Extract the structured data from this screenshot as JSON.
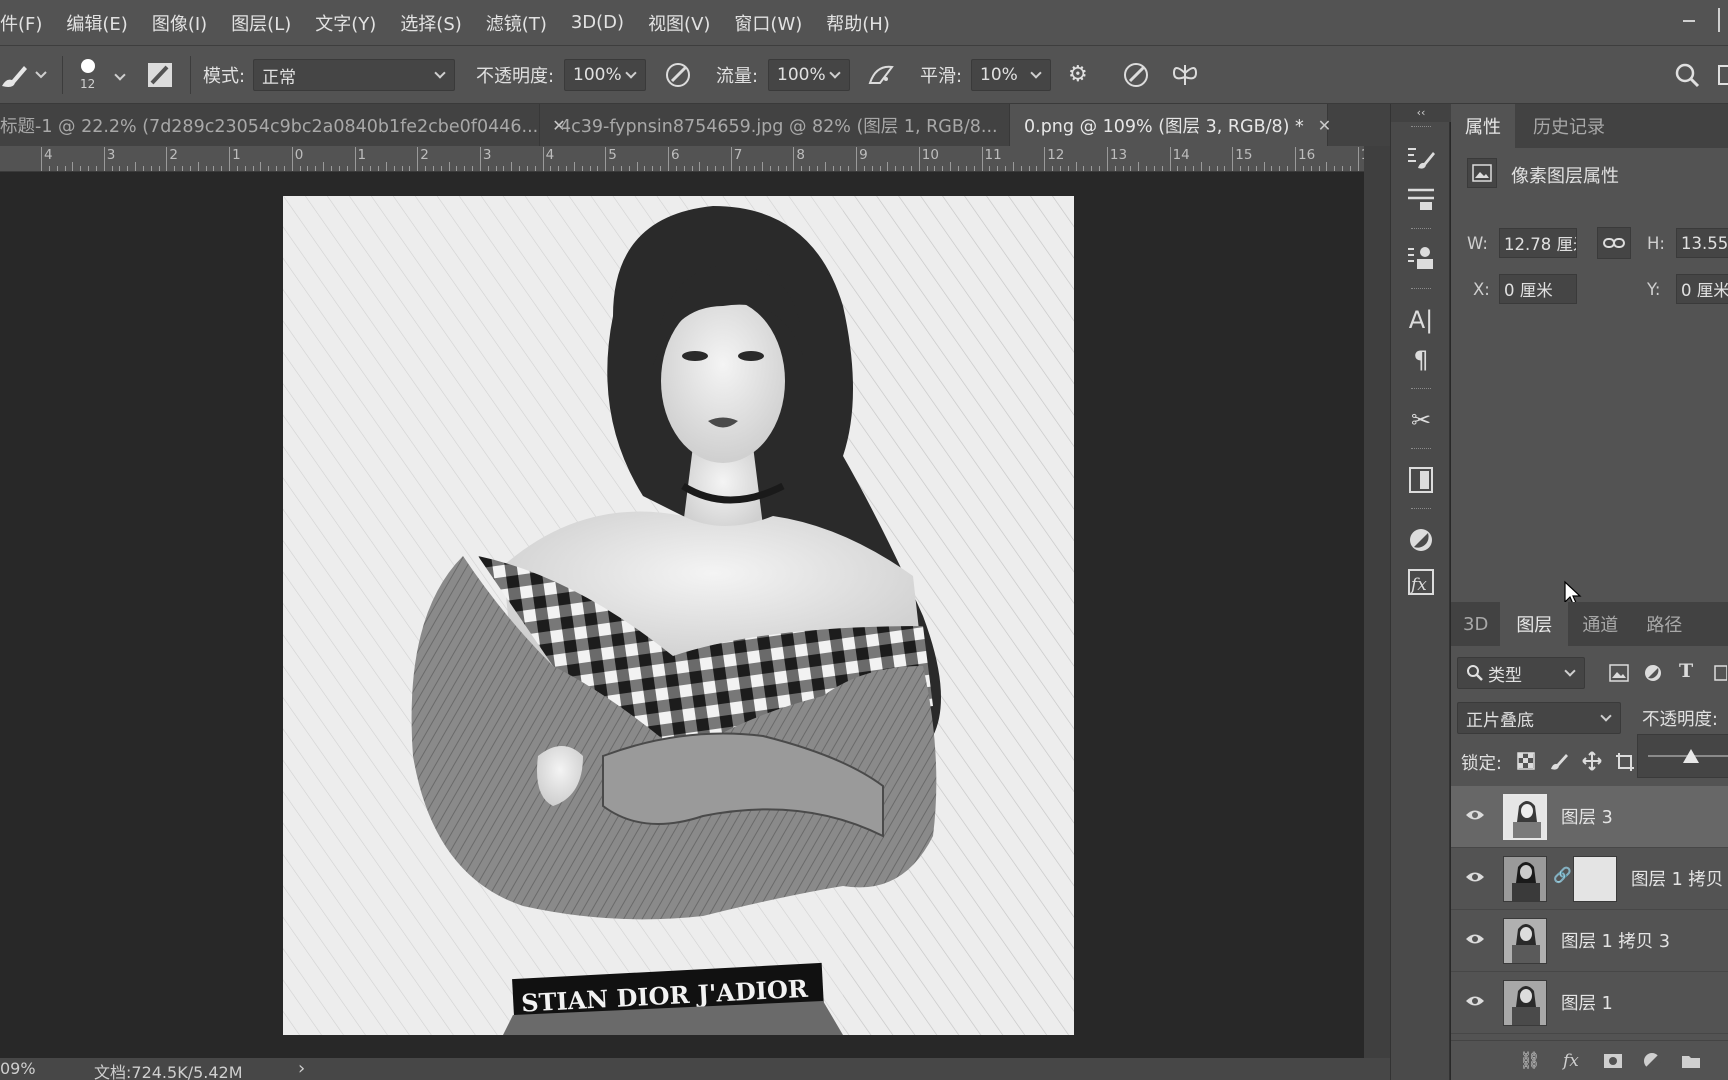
{
  "menu": [
    "件(F)",
    "编辑(E)",
    "图像(I)",
    "图层(L)",
    "文字(Y)",
    "选择(S)",
    "滤镜(T)",
    "3D(D)",
    "视图(V)",
    "窗口(W)",
    "帮助(H)"
  ],
  "options": {
    "brush_size": "12",
    "mode_label": "模式:",
    "mode_value": "正常",
    "opacity_label": "不透明度:",
    "opacity_value": "100%",
    "flow_label": "流量:",
    "flow_value": "100%",
    "smooth_label": "平滑:",
    "smooth_value": "10%"
  },
  "doc_tabs": [
    {
      "label": "标题-1 @ 22.2% (7d289c23054c9bc2a0840b1fe2cbe0f0446...",
      "active": false
    },
    {
      "label": "4c39-fypnsin8754659.jpg @ 82% (图层 1, RGB/8...",
      "active": false
    },
    {
      "label": "0.png @ 109% (图层 3, RGB/8) *",
      "active": true
    }
  ],
  "ruler_numbers": [
    "4",
    "3",
    "2",
    "1",
    "0",
    "1",
    "2",
    "3",
    "4",
    "5",
    "6",
    "7",
    "8",
    "9",
    "10",
    "11",
    "12",
    "13",
    "14",
    "15",
    "16",
    "17"
  ],
  "image_text": "STIAN DIOR J'ADIOR",
  "status": {
    "zoom": "09%",
    "doc_size": "文档:724.5K/5.42M",
    "arrow": "›"
  },
  "toolstrip": {
    "collapse": "‹‹"
  },
  "properties": {
    "tabs": [
      "属性",
      "历史记录"
    ],
    "header": "像素图层属性",
    "w_label": "W:",
    "w_value": "12.78 厘米",
    "h_label": "H:",
    "h_value": "13.55",
    "x_label": "X:",
    "x_value": "0 厘米",
    "y_label": "Y:",
    "y_value": "0 厘米"
  },
  "layers_panel": {
    "tabs": [
      "3D",
      "图层",
      "通道",
      "路径"
    ],
    "filter_value": "类型",
    "blend_mode": "正片叠底",
    "opacity_label": "不透明度:",
    "lock_label": "锁定:",
    "layers": [
      {
        "name": "图层 3",
        "selected": true
      },
      {
        "name": "图层 1 拷贝",
        "selected": false
      },
      {
        "name": "图层 1 拷贝 3",
        "selected": false
      },
      {
        "name": "图层 1",
        "selected": false
      }
    ]
  }
}
